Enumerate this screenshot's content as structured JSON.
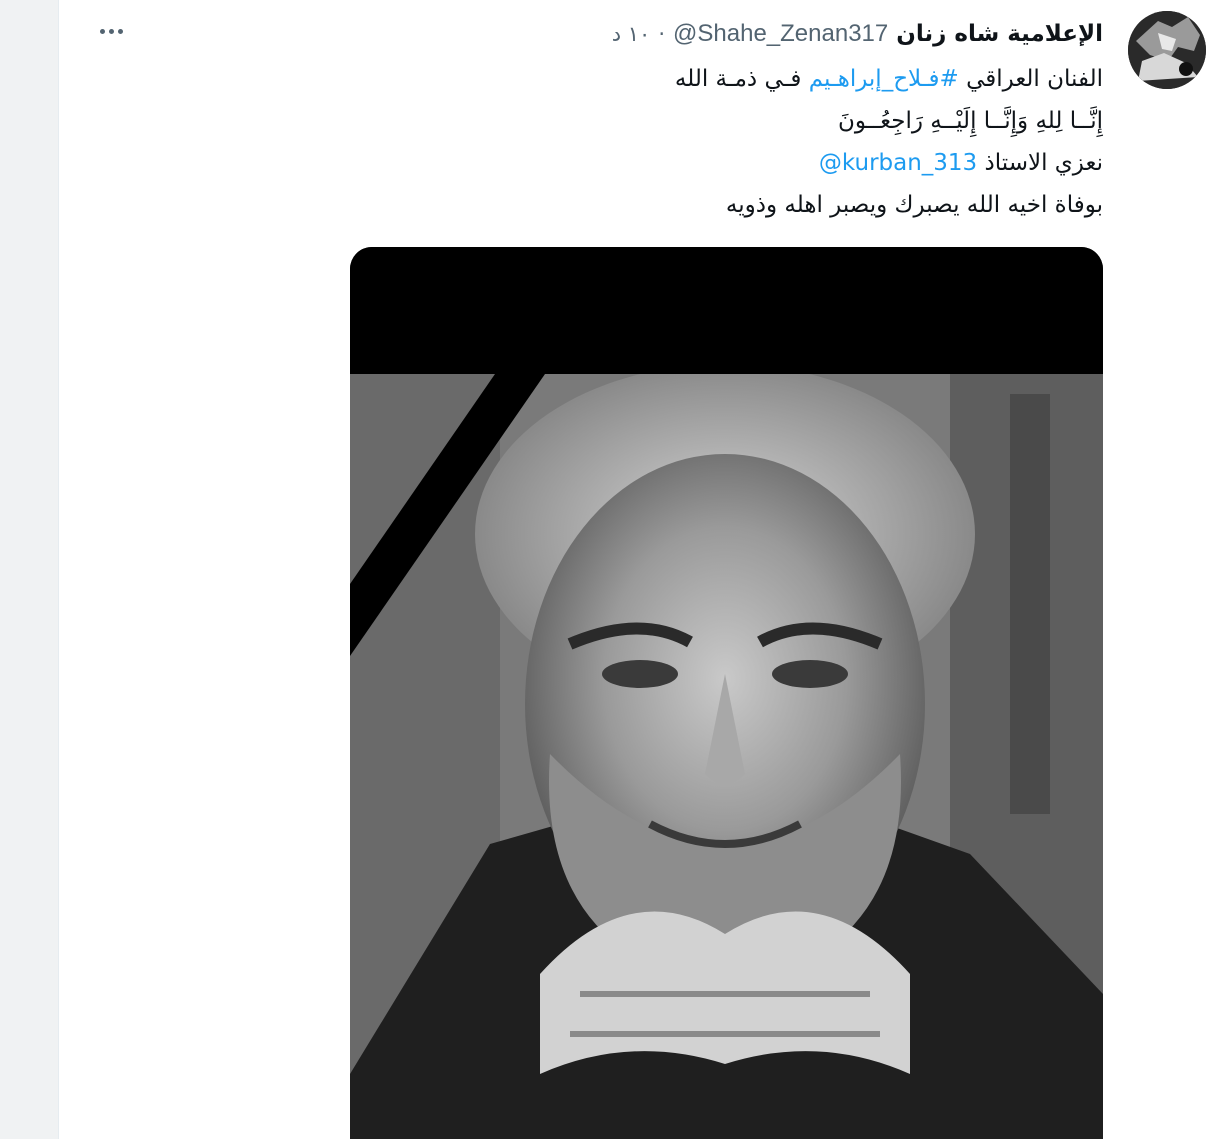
{
  "tweet": {
    "display_name": "الإعلامية شاه زنان",
    "handle": "@Shahe_Zenan317",
    "separator": "·",
    "time": "١٠ د",
    "line1_text": "الفنان العراقي",
    "line1_hashtag": "#فـلاح_إبراهـيم",
    "line1_tail": "فـي ذمـة الله",
    "line2": "إِنَّــا لِلهِ وَإِنَّــا إِلَيْــهِ رَاجِعُــونَ",
    "line3_text": "نعزي الاستاذ",
    "line3_mention": "@kurban_313",
    "line4": "بوفاة اخيه الله يصبرك ويصبر اهله وذويه"
  },
  "icons": {
    "more": "more-horizontal-icon"
  },
  "colors": {
    "link": "#1d9bf0",
    "text": "#0f1419",
    "secondary": "#536471"
  }
}
